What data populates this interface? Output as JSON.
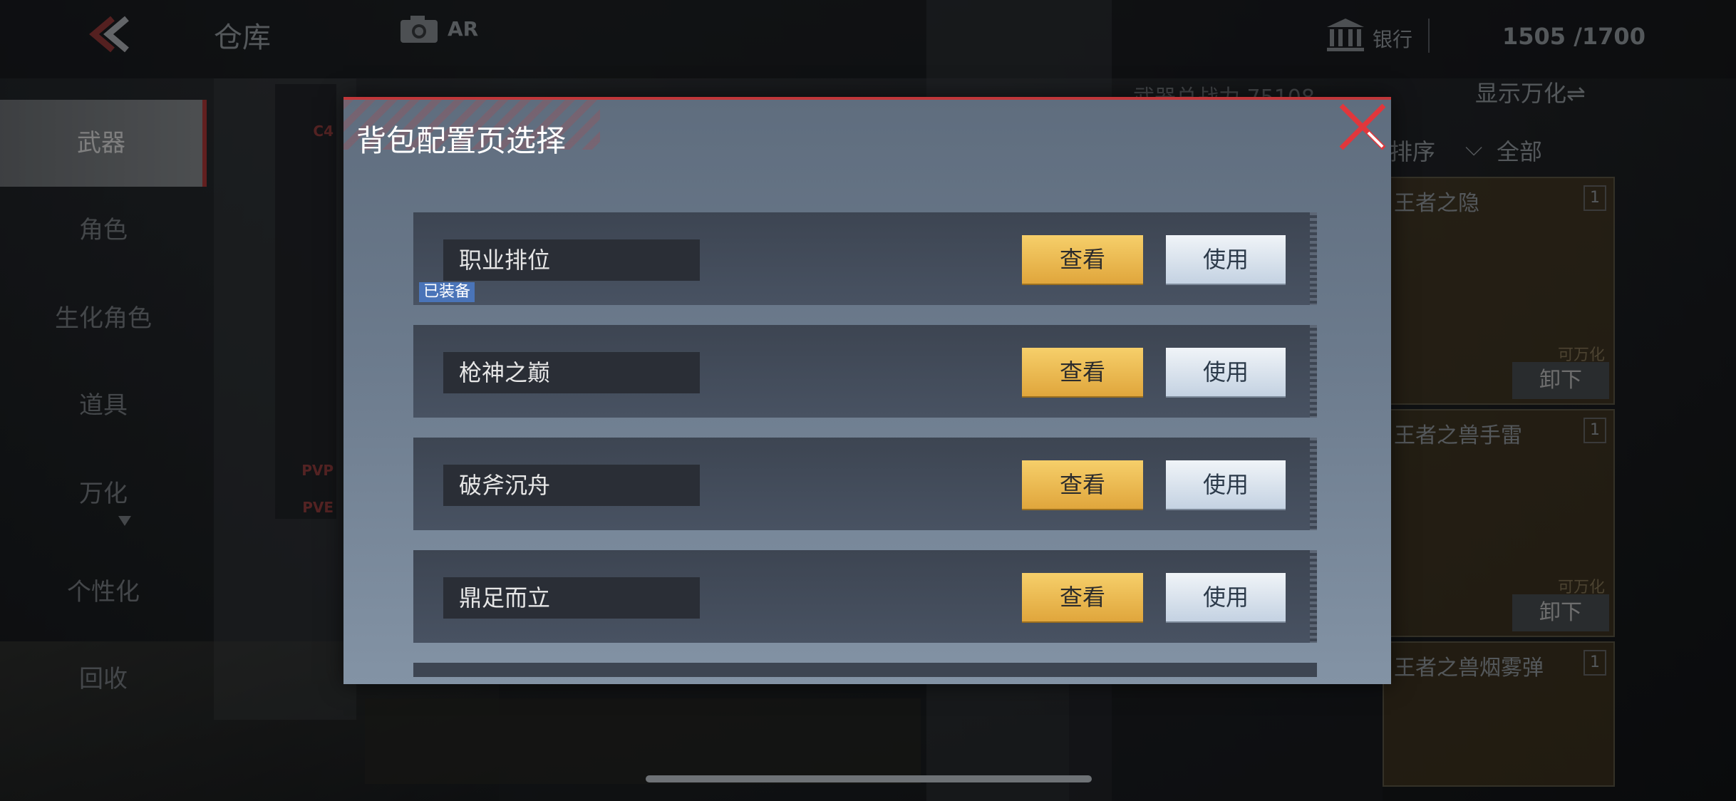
{
  "header": {
    "title": "仓库",
    "ar_label": "AR",
    "bank_label": "银行",
    "capacity": "1505 /1700"
  },
  "left_menu": {
    "items": [
      {
        "label": "武器",
        "active": true
      },
      {
        "label": "角色",
        "active": false
      },
      {
        "label": "生化角色",
        "active": false
      },
      {
        "label": "道具",
        "active": false
      },
      {
        "label": "万化",
        "active": false
      },
      {
        "label": "个性化",
        "active": false
      },
      {
        "label": "回收",
        "active": false
      }
    ]
  },
  "slots": {
    "tags": [
      "C4",
      "PVP",
      "PVE"
    ]
  },
  "right_panel": {
    "power_label": "武器总战力 75108",
    "show_toggle": "显示万化⇌",
    "sort_label": "排序",
    "filter_label": "全部",
    "cards": [
      {
        "name": "王者之隐",
        "count": "1",
        "tag": "可万化",
        "action": "卸下"
      },
      {
        "name": "王者之兽手雷",
        "count": "1",
        "tag": "可万化",
        "action": "卸下"
      },
      {
        "name": "王者之兽烟雾弹",
        "count": "1",
        "tag": "",
        "action": ""
      }
    ]
  },
  "dialog": {
    "title": "背包配置页选择",
    "rows": [
      {
        "name": "职业排位",
        "equipped_badge": "已装备",
        "view_label": "查看",
        "use_label": "使用"
      },
      {
        "name": "枪神之巅",
        "equipped_badge": "",
        "view_label": "查看",
        "use_label": "使用"
      },
      {
        "name": "破斧沉舟",
        "equipped_badge": "",
        "view_label": "查看",
        "use_label": "使用"
      },
      {
        "name": "鼎足而立",
        "equipped_badge": "",
        "view_label": "查看",
        "use_label": "使用"
      }
    ]
  },
  "colors": {
    "accent_red": "#c0373a",
    "view_button": "#f0c25a",
    "use_button": "#dbe5ef",
    "equipped_badge": "#4a74b8"
  }
}
